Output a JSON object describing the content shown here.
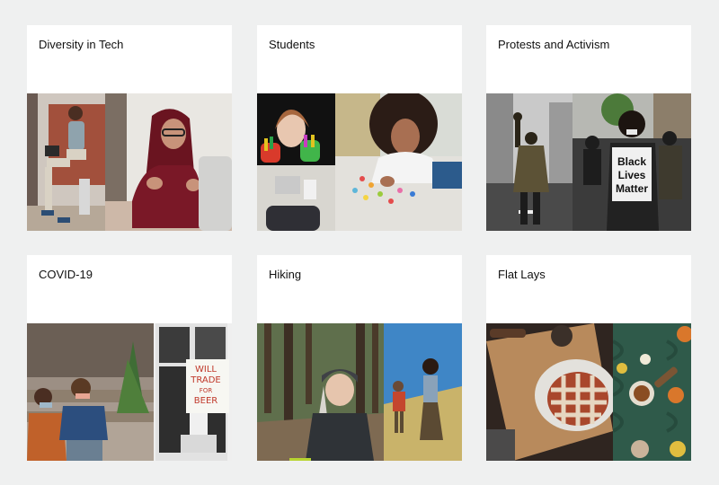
{
  "collections": [
    {
      "title": "Diversity in Tech",
      "photos": [
        "man-with-laptop-photo",
        "woman-in-hijab-on-call-photo"
      ]
    },
    {
      "title": "Students",
      "photos": [
        "child-painted-hands-photo",
        "girl-playing-with-beads-photo"
      ]
    },
    {
      "title": "Protests and Activism",
      "photos": [
        "protester-raised-fist-photo",
        "black-lives-matter-sign-photo"
      ],
      "sign": {
        "line1": "Black",
        "line2": "Lives",
        "line3": "Matter"
      }
    },
    {
      "title": "COVID-19",
      "photos": [
        "couple-in-masks-on-stoop-photo",
        "window-sign-photo"
      ],
      "sign": {
        "line1": "WILL",
        "line2": "TRADE",
        "line3": "FOR",
        "line4": "BEER"
      }
    },
    {
      "title": "Hiking",
      "photos": [
        "smiling-woman-hiker-photo",
        "hikers-on-trail-photo"
      ]
    },
    {
      "title": "Flat Lays",
      "photos": [
        "pie-on-cutting-board-photo",
        "sweater-with-tea-photo"
      ]
    }
  ]
}
